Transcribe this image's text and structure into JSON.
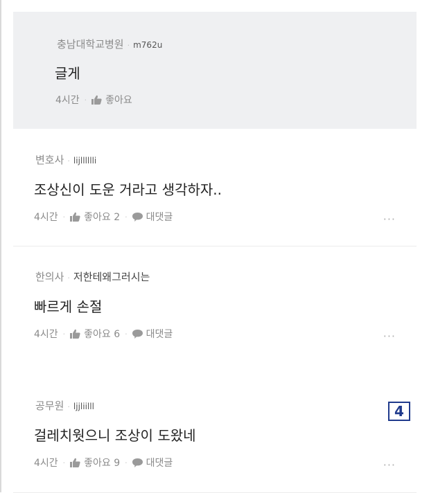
{
  "sep": "·",
  "reply": {
    "job": "충남대학교병원",
    "user": "m762u",
    "body": "글게",
    "time": "4시간",
    "like_label": "좋아요"
  },
  "comments": [
    {
      "job": "변호사",
      "user": "lijlllllli",
      "body": "조상신이 도운 거라고 생각하자..",
      "time": "4시간",
      "like_label": "좋아요 2",
      "reply_label": "대댓글",
      "more_label": "···"
    },
    {
      "job": "한의사",
      "user": "저한테왜그러시는",
      "body": "빠르게 손절",
      "time": "4시간",
      "like_label": "좋아요 6",
      "reply_label": "대댓글",
      "more_label": "···"
    },
    {
      "job": "공무원",
      "user": "ljjliilll",
      "body": "걸레치웟으니 조상이 도왔네",
      "time": "4시간",
      "like_label": "좋아요 9",
      "reply_label": "대댓글",
      "more_label": "···"
    }
  ],
  "page_badge": "4",
  "colors": {
    "reply_bg": "#eff0f2",
    "text": "#222222",
    "meta": "#8a8a8a",
    "badge": "#1f3a8c"
  }
}
